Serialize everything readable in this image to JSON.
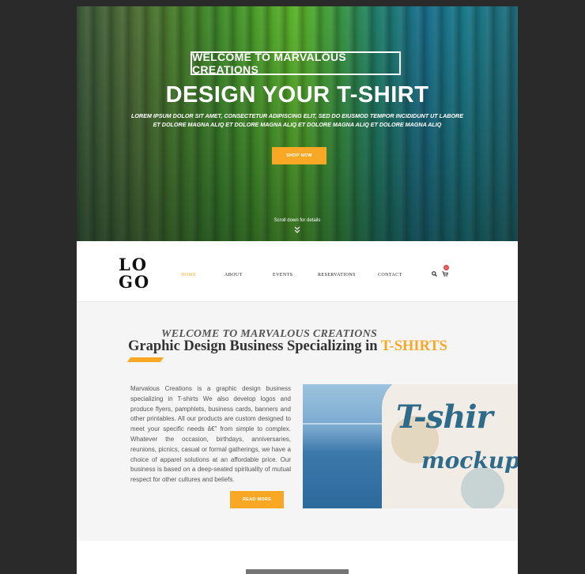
{
  "hero": {
    "badge": "WELCOME TO MARVALOUS CREATIONS",
    "title": "DESIGN YOUR T-SHIRT",
    "subtitle_line1": "LOREM IPSUM DOLOR SIT AMET, CONSECTETUR ADIPISCING ELIT, SED DO EIUSMOD TEMPOR INCIDIDUNT UT LABORE",
    "subtitle_line2": "ET DOLORE MAGNA ALIQ  ET DOLORE MAGNA ALIQ  ET DOLORE MAGNA ALIQ  ET DOLORE MAGNA ALIQ",
    "button": "SHOP NOW",
    "scroll_text": "Scroll down for details",
    "scroll_icon": "chevron-double-down-icon"
  },
  "nav": {
    "logo_line1": "LO",
    "logo_line2": "GO",
    "items": [
      "HOME",
      "ABOUT",
      "EVENTS",
      "RESERVATIONS",
      "CONTACT"
    ],
    "active": "HOME",
    "cart_count": "0",
    "search_icon": "search-icon",
    "cart_icon": "cart-icon"
  },
  "about": {
    "pretitle": "WELCOME TO MARVALOUS CREATIONS",
    "title": "Graphic Design Business Specializing in",
    "title_highlight": "T-SHIRTS",
    "body": "Marvalous Creations is a graphic design business specializing in T-shirts We also develop logos and produce flyers, pamphlets, business cards, banners and other printables. All our products are custom designed to meet your specific needs â€\" from simple to complex. Whatever the occasion, birthdays, anniversaries, reunions, picnics, casual or formal gatherings, we have a choice of apparel solutions at an affordable price. Our business is based on a deep-seated spirituality of mutual respect for other cultures and beliefs.",
    "button": "READ MORE",
    "image_print_top": "T-shir",
    "image_print_bottom": "mockup"
  },
  "colors": {
    "accent": "#f9a826",
    "background": "#2a2a2a",
    "section_bg": "#f5f5f5",
    "badge_red": "#e24b4b"
  }
}
